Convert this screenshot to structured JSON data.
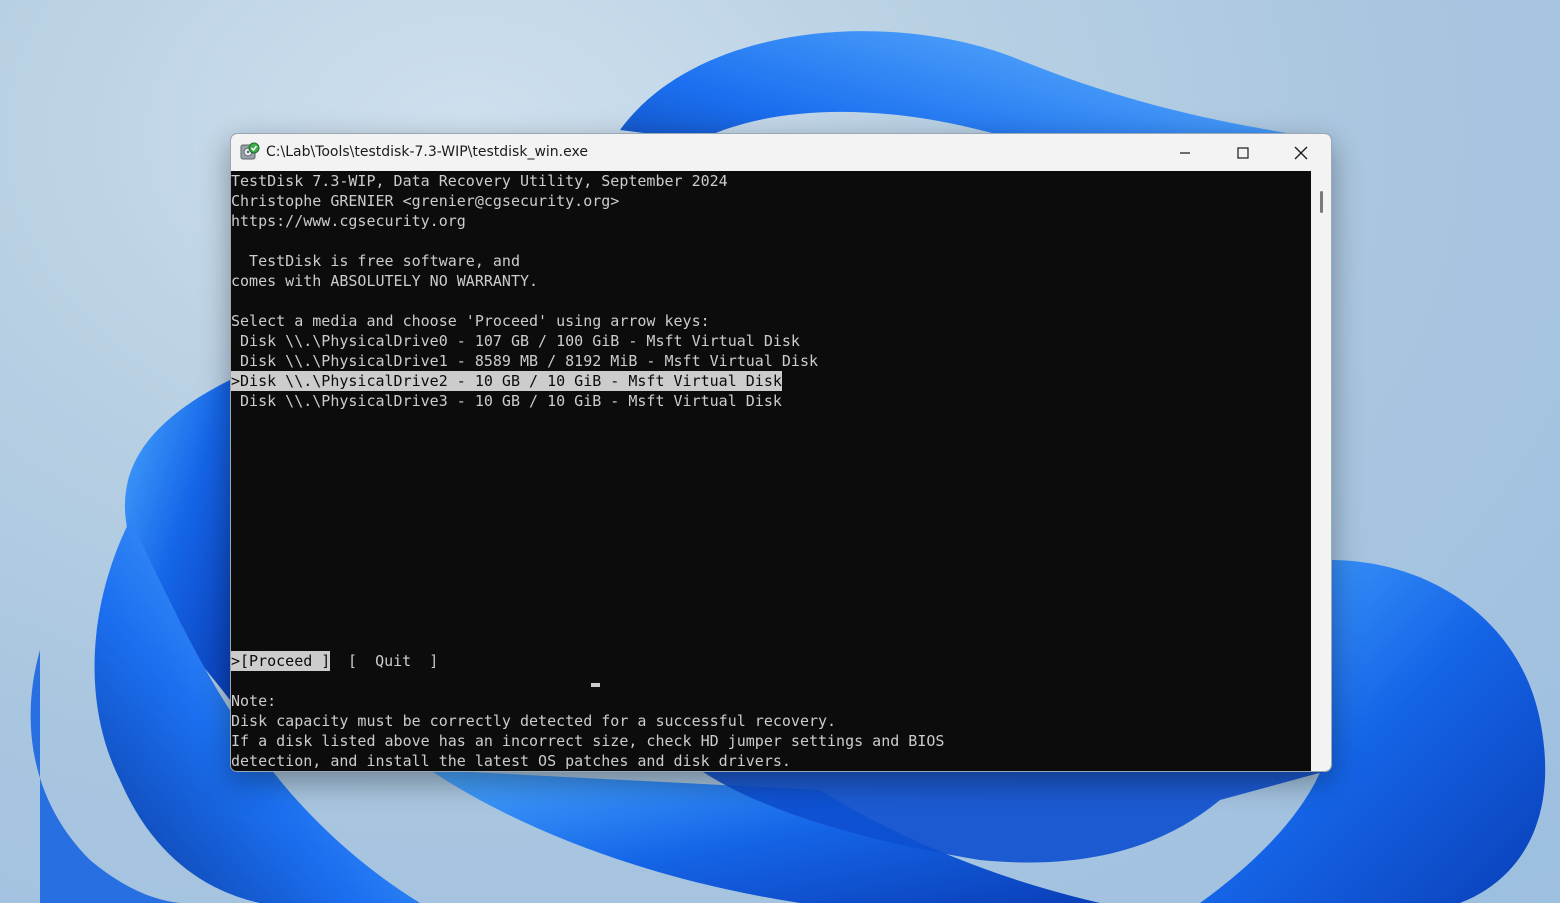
{
  "window": {
    "title": "C:\\Lab\\Tools\\testdisk-7.3-WIP\\testdisk_win.exe",
    "controls": {
      "minimize": "minimize-icon",
      "maximize": "maximize-icon",
      "close": "close-icon"
    }
  },
  "console": {
    "header": [
      "TestDisk 7.3-WIP, Data Recovery Utility, September 2024",
      "Christophe GRENIER <grenier@cgsecurity.org>",
      "https://www.cgsecurity.org"
    ],
    "license": [
      "  TestDisk is free software, and",
      "comes with ABSOLUTELY NO WARRANTY."
    ],
    "prompt": "Select a media and choose 'Proceed' using arrow keys:",
    "disks": [
      " Disk \\\\.\\PhysicalDrive0 - 107 GB / 100 GiB - Msft Virtual Disk",
      " Disk \\\\.\\PhysicalDrive1 - 8589 MB / 8192 MiB - Msft Virtual Disk",
      ">Disk \\\\.\\PhysicalDrive2 - 10 GB / 10 GiB - Msft Virtual Disk",
      " Disk \\\\.\\PhysicalDrive3 - 10 GB / 10 GiB - Msft Virtual Disk"
    ],
    "selected_disk_index": 2,
    "actions": {
      "proceed": ">[Proceed ]",
      "quit": "[  Quit  ]"
    },
    "note": [
      "Note:",
      "Disk capacity must be correctly detected for a successful recovery.",
      "If a disk listed above has an incorrect size, check HD jumper settings and BIOS",
      "detection, and install the latest OS patches and disk drivers."
    ]
  },
  "colors": {
    "console_bg": "#0c0c0c",
    "console_fg": "#cccccc",
    "titlebar_bg": "#f3f3f3",
    "wallpaper_accent": "#1a6cf0"
  }
}
